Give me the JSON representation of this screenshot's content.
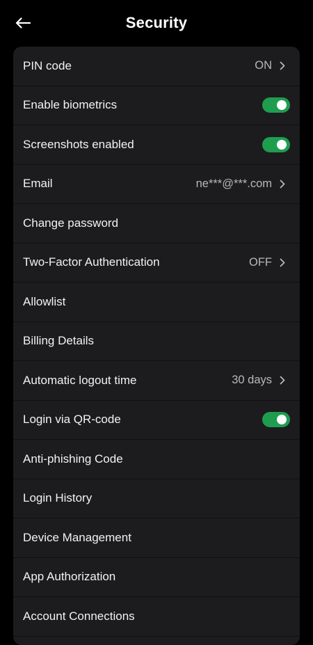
{
  "header": {
    "title": "Security",
    "back_icon": "arrow-left-icon"
  },
  "colors": {
    "background": "#000000",
    "card": "#1c1c1e",
    "toggle_on": "#1f9d4f",
    "value_text": "#b8b8bc"
  },
  "settings": [
    {
      "label": "PIN code",
      "value": "ON",
      "control": "chevron"
    },
    {
      "label": "Enable biometrics",
      "value": "",
      "control": "toggle",
      "toggle_on": true
    },
    {
      "label": "Screenshots enabled",
      "value": "",
      "control": "toggle",
      "toggle_on": true
    },
    {
      "label": "Email",
      "value": "ne***@***.com",
      "control": "chevron"
    },
    {
      "label": "Change password",
      "value": "",
      "control": "none"
    },
    {
      "label": "Two-Factor Authentication",
      "value": "OFF",
      "control": "chevron"
    },
    {
      "label": "Allowlist",
      "value": "",
      "control": "none"
    },
    {
      "label": "Billing Details",
      "value": "",
      "control": "none"
    },
    {
      "label": "Automatic logout time",
      "value": "30 days",
      "control": "chevron"
    },
    {
      "label": "Login via QR-code",
      "value": "",
      "control": "toggle",
      "toggle_on": true
    },
    {
      "label": "Anti-phishing Code",
      "value": "",
      "control": "none"
    },
    {
      "label": "Login History",
      "value": "",
      "control": "none"
    },
    {
      "label": "Device Management",
      "value": "",
      "control": "none"
    },
    {
      "label": "App Authorization",
      "value": "",
      "control": "none"
    },
    {
      "label": "Account Connections",
      "value": "",
      "control": "none"
    }
  ]
}
